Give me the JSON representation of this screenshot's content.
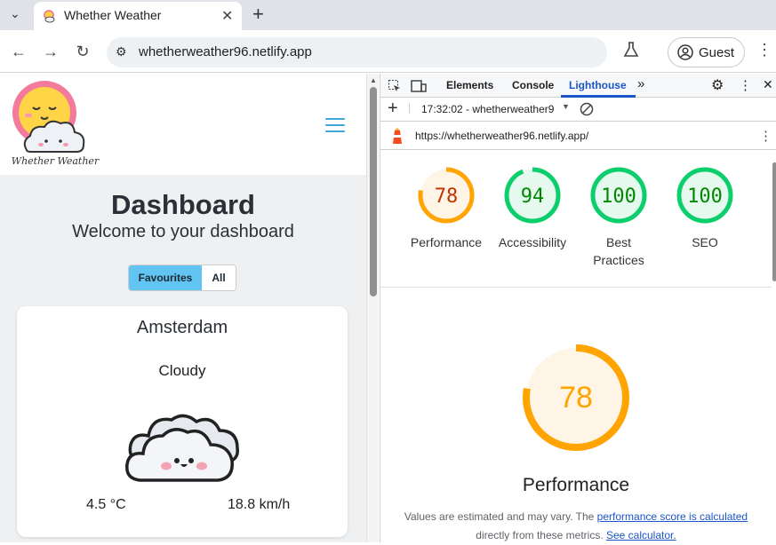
{
  "browser": {
    "tab_title": "Whether Weather",
    "url": "whetherweather96.netlify.app",
    "profile_label": "Guest"
  },
  "page": {
    "logo_text": "Whether Weather",
    "title": "Dashboard",
    "subtitle": "Welcome to your dashboard",
    "toggle": {
      "favourites_label": "Favourites",
      "all_label": "All",
      "selected": "Favourites"
    },
    "card": {
      "city": "Amsterdam",
      "condition": "Cloudy",
      "temperature": "4.5 °C",
      "wind": "18.8 km/h"
    }
  },
  "devtools": {
    "tabs": [
      "Elements",
      "Console",
      "Lighthouse"
    ],
    "active_tab": "Lighthouse",
    "report_selector": "17:32:02 - whetherweather9",
    "report_url": "https://whetherweather96.netlify.app/",
    "scores": [
      {
        "label": "Performance",
        "value": 78,
        "color": "#ffa400"
      },
      {
        "label": "Accessibility",
        "value": 94,
        "color": "#0cce6b"
      },
      {
        "label_line1": "Best",
        "label_line2": "Practices",
        "value": 100,
        "color": "#0cce6b"
      },
      {
        "label": "SEO",
        "value": 100,
        "color": "#0cce6b"
      }
    ],
    "main_score": {
      "label": "Performance",
      "value": 78,
      "color": "#ffa400"
    },
    "note": {
      "prefix": "Values are estimated and may vary. The ",
      "link1": "performance score is calculated",
      "middle": "directly from these metrics. ",
      "link2": "See calculator."
    }
  },
  "colors": {
    "accent_blue": "#62c4f2",
    "orange": "#ffa400",
    "green": "#0cce6b",
    "link_blue": "#1a56c9"
  }
}
